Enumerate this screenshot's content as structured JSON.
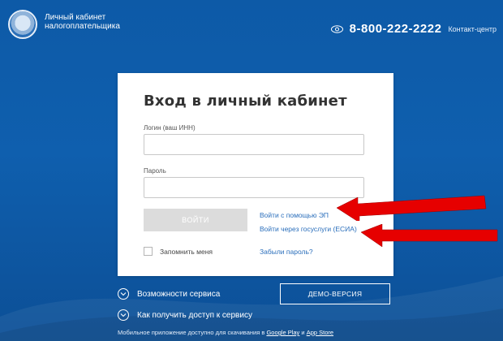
{
  "header": {
    "title_line1": "Личный кабинет",
    "title_line2": "налогоплательщика",
    "phone": "8-800-222-2222",
    "contact_label": "Контакт-центр"
  },
  "login_form": {
    "title": "Вход в личный кабинет",
    "login_label": "Логин (ваш ИНН)",
    "login_value": "",
    "password_label": "Пароль",
    "password_value": "",
    "submit_label": "ВОЙТИ",
    "link_ep": "Войти с помощью ЭП",
    "link_esia": "Войти через госуслуги (ЕСИА)",
    "remember_label": "Запомнить меня",
    "remember_checked": false,
    "forgot_label": "Забыли пароль?"
  },
  "below_card": {
    "features_label": "Возможности сервиса",
    "access_label": "Как получить доступ к сервису",
    "demo_label": "ДЕМО-ВЕРСИЯ",
    "mobile_prefix": "Мобильное приложение доступно для скачивания в",
    "google_play": "Google Play",
    "and": "и",
    "app_store": "App Store"
  },
  "icons": {
    "logo": "fns-emblem-icon",
    "eye": "eye-icon",
    "chevron": "chevron-down-icon",
    "annotation_arrow": "red-arrow-icon"
  },
  "colors": {
    "background": "#0f5fae",
    "link": "#2a6ebb",
    "button_disabled": "#dcdcdc",
    "arrow": "#e60000"
  }
}
